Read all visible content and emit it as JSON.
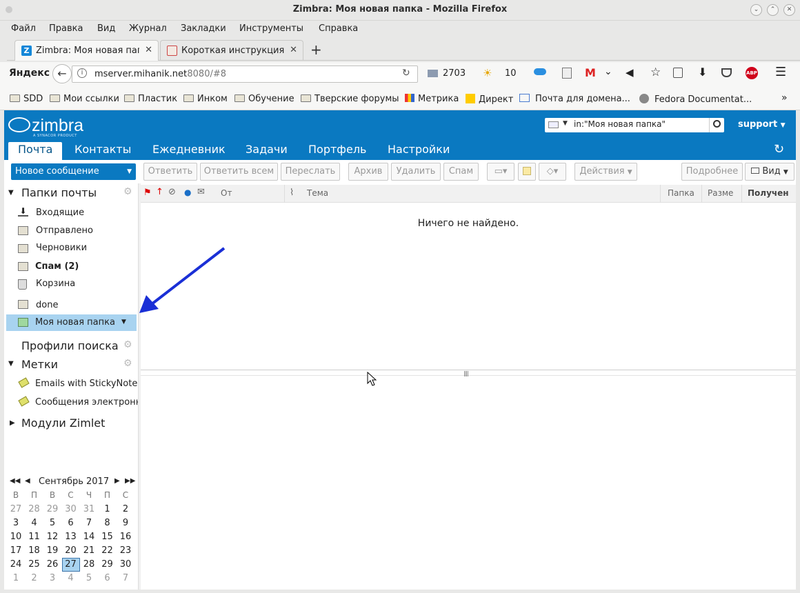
{
  "window": {
    "title": "Zimbra: Моя новая папка - Mozilla Firefox"
  },
  "menu": [
    "Файл",
    "Правка",
    "Вид",
    "Журнал",
    "Закладки",
    "Инструменты",
    "Справка"
  ],
  "tabs": [
    {
      "label": "Zimbra: Моя новая пап"
    },
    {
      "label": "Короткая инструкция"
    }
  ],
  "nav": {
    "yandex": "Яндекс",
    "url_host": "mserver.mihanik.net",
    "url_rest": ":8080/#8",
    "mail_count": "2703",
    "weather": "10"
  },
  "bookmarks": [
    "SDD",
    "Мои ссылки",
    "Пластик",
    "Инком",
    "Обучение",
    "Тверские форумы",
    "Метрика",
    "Директ",
    "Почта для домена...",
    "Fedora Documentat..."
  ],
  "zimbra": {
    "logo": "zimbra",
    "logo_sub": "A SYNACOR PRODUCT",
    "search_value": "in:\"Моя новая папка\"",
    "user": "support",
    "apptabs": [
      "Почта",
      "Контакты",
      "Ежедневник",
      "Задачи",
      "Портфель",
      "Настройки"
    ],
    "new_message": "Новое сообщение",
    "toolbar": {
      "reply": "Ответить",
      "reply_all": "Ответить всем",
      "forward": "Переслать",
      "archive": "Архив",
      "delete": "Удалить",
      "spam": "Спам",
      "actions": "Действия",
      "more": "Подробнее",
      "view": "Вид"
    },
    "sidebar": {
      "mail_folders": "Папки почты",
      "folders": [
        {
          "label": "Входящие"
        },
        {
          "label": "Отправлено"
        },
        {
          "label": "Черновики"
        },
        {
          "label": "Спам (2)"
        },
        {
          "label": "Корзина"
        },
        {
          "label": "done"
        },
        {
          "label": "Моя новая папка"
        }
      ],
      "search_profiles": "Профили поиска",
      "tags": "Метки",
      "tag_items": [
        "Emails with StickyNotes",
        "Сообщения электронно"
      ],
      "zimlets": "Модули Zimlet"
    },
    "list": {
      "col_from": "От",
      "col_subject": "Тема",
      "col_folder": "Папка",
      "col_size": "Разме",
      "col_received": "Получен",
      "empty": "Ничего не найдено."
    },
    "calendar": {
      "month": "Сентябрь 2017",
      "weekdays": [
        "В",
        "П",
        "В",
        "С",
        "Ч",
        "П",
        "С"
      ],
      "weeks": [
        [
          "27",
          "28",
          "29",
          "30",
          "31",
          "1",
          "2"
        ],
        [
          "3",
          "4",
          "5",
          "6",
          "7",
          "8",
          "9"
        ],
        [
          "10",
          "11",
          "12",
          "13",
          "14",
          "15",
          "16"
        ],
        [
          "17",
          "18",
          "19",
          "20",
          "21",
          "22",
          "23"
        ],
        [
          "24",
          "25",
          "26",
          "27",
          "28",
          "29",
          "30"
        ],
        [
          "1",
          "2",
          "3",
          "4",
          "5",
          "6",
          "7"
        ]
      ],
      "today": "27"
    }
  },
  "colors": {
    "zimbra_blue": "#0a79c1",
    "selected_folder": "#a8d3f0",
    "arrow": "#1a2fd6"
  }
}
